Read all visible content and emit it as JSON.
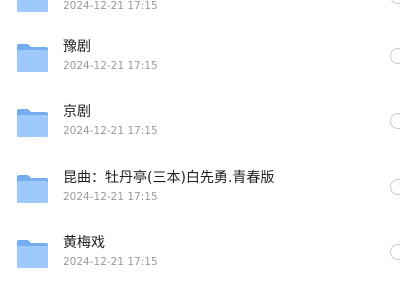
{
  "colors": {
    "folder_back": "#74aef0",
    "folder_front": "#9ec9fa",
    "name_text": "#1f1f1f",
    "date_text": "#9a9a9a",
    "radio_border": "#c9c9c9"
  },
  "items": [
    {
      "name": "",
      "date": "2024-12-21 17:15",
      "icon": "folder-icon"
    },
    {
      "name": "豫剧",
      "date": "2024-12-21 17:15",
      "icon": "folder-icon"
    },
    {
      "name": "京剧",
      "date": "2024-12-21 17:15",
      "icon": "folder-icon"
    },
    {
      "name": "昆曲：牡丹亭(三本)白先勇.青春版",
      "date": "2024-12-21 17:15",
      "icon": "folder-icon"
    },
    {
      "name": "黄梅戏",
      "date": "2024-12-21 17:15",
      "icon": "folder-icon"
    }
  ]
}
